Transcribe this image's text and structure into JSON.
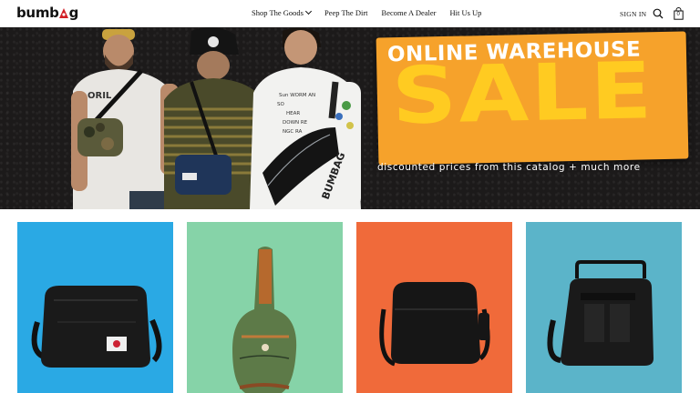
{
  "header": {
    "logo_text_a": "bumb",
    "logo_text_b": "g",
    "nav": [
      {
        "label": "Shop The Goods",
        "has_dropdown": true
      },
      {
        "label": "Peep The Dirt",
        "has_dropdown": false
      },
      {
        "label": "Become A Dealer",
        "has_dropdown": false
      },
      {
        "label": "Hit Us Up",
        "has_dropdown": false
      }
    ],
    "sign_in": "SIGN IN",
    "cart_count": "0"
  },
  "hero": {
    "headline_line1": "ONLINE WAREHOUSE",
    "headline_line2": "SALE",
    "subtext": "discounted prices from this catalog + much more",
    "sign_color": "#f6a22b",
    "sign_accent": "#ffcb21"
  },
  "products": [
    {
      "bg_color": "#2aa9e4",
      "icon": "black-camera-bag-icon"
    },
    {
      "bg_color": "#86d3a8",
      "icon": "green-guitar-case-icon"
    },
    {
      "bg_color": "#f06a3a",
      "icon": "black-messenger-bag-icon"
    },
    {
      "bg_color": "#5bb4c9",
      "icon": "black-utility-bag-icon"
    }
  ]
}
